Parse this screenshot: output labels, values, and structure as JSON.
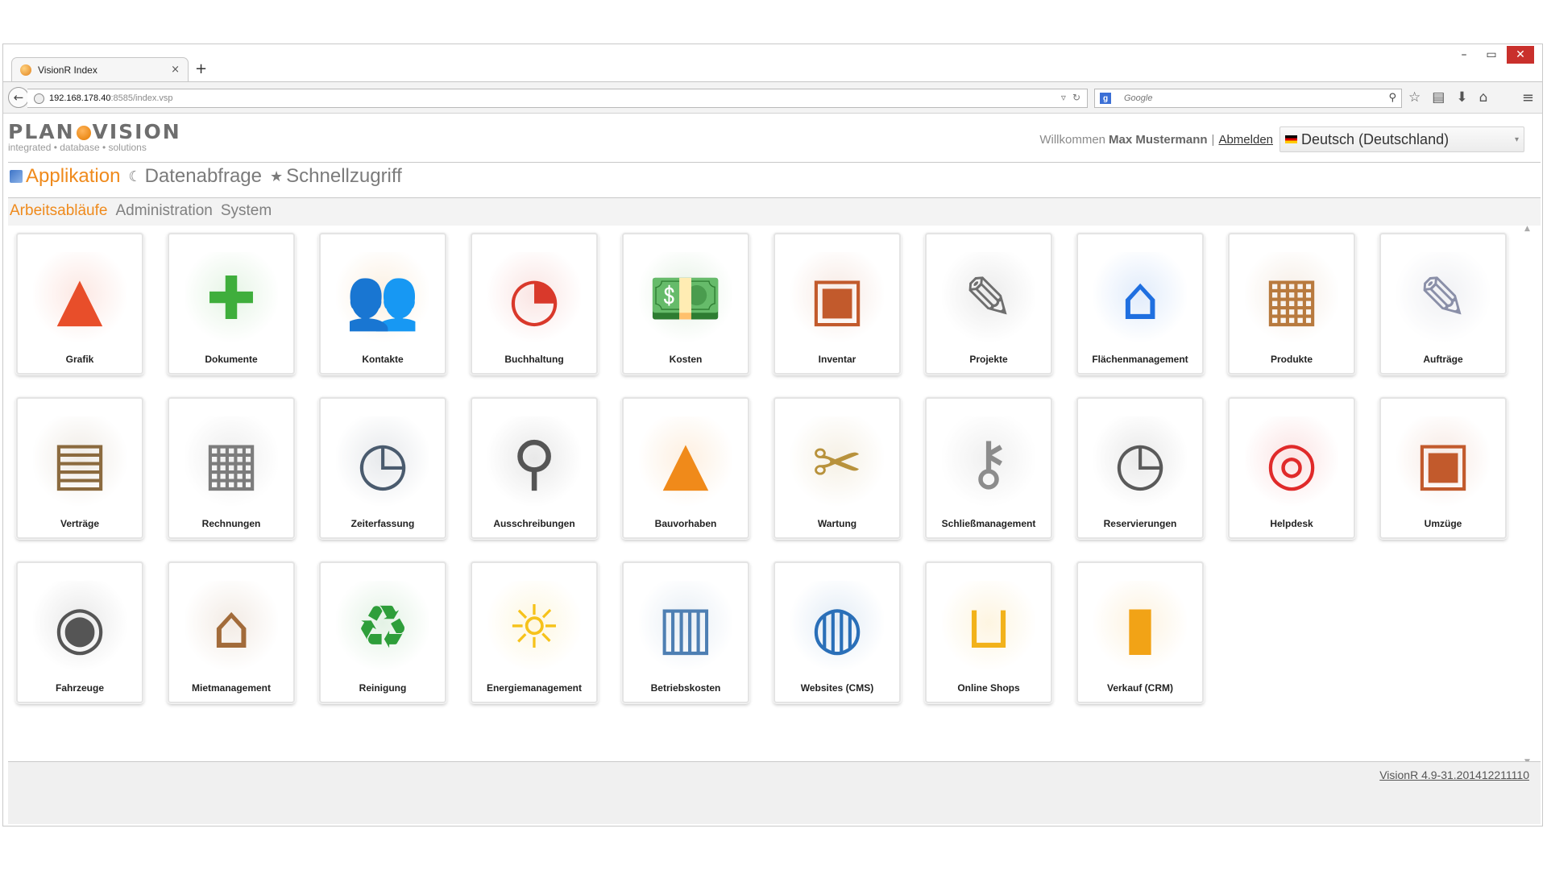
{
  "browser": {
    "tab_title": "VisionR Index",
    "tab_close": "×",
    "new_tab": "+",
    "window_controls": {
      "minimize": "–",
      "maximize": "▭",
      "close": "✕"
    },
    "url_host": "192.168.178.40",
    "url_path": ":8585/index.vsp",
    "url_icons": {
      "dropdown": "▿",
      "reload": "↻"
    },
    "search_engine_icon": "g",
    "search_placeholder": "Google",
    "search_glyph": "⚲",
    "toolbar": {
      "bookmark_star": "☆",
      "bookmarks_list": "▤",
      "download": "⬇",
      "home": "⌂",
      "menu": "≡"
    },
    "back": "←"
  },
  "header": {
    "logo_left": "PLAN",
    "logo_right": "VISION",
    "tagline": "integrated • database • solutions",
    "welcome": "Willkommen",
    "user_name": "Max Mustermann",
    "separator": "|",
    "logout": "Abmelden",
    "language": "Deutsch (Deutschland)",
    "language_arrow": "▾"
  },
  "main_nav": [
    {
      "label": "Applikation",
      "icon": "app-icon"
    },
    {
      "label": "Datenabfrage",
      "icon": "query-icon",
      "glyph": "☾"
    },
    {
      "label": "Schnellzugriff",
      "icon": "star-icon",
      "glyph": "★"
    }
  ],
  "sub_nav": [
    "Arbeitsabläufe",
    "Administration",
    "System"
  ],
  "tiles": [
    {
      "label": "Grafik",
      "icon": "graphic-shapes-icon",
      "glyph": "▲",
      "color": "#e84e2a"
    },
    {
      "label": "Dokumente",
      "icon": "documents-folder-icon",
      "glyph": "✚",
      "color": "#3fae3c"
    },
    {
      "label": "Kontakte",
      "icon": "contacts-people-icon",
      "glyph": "👥",
      "color": "#e28a1e"
    },
    {
      "label": "Buchhaltung",
      "icon": "accounting-chart-icon",
      "glyph": "◔",
      "color": "#d9392b"
    },
    {
      "label": "Kosten",
      "icon": "money-icon",
      "glyph": "💵",
      "color": "#3c9a3c"
    },
    {
      "label": "Inventar",
      "icon": "inventory-box-icon",
      "glyph": "▣",
      "color": "#c25a2c"
    },
    {
      "label": "Projekte",
      "icon": "projects-calendar-icon",
      "glyph": "✎",
      "color": "#6e6e6e"
    },
    {
      "label": "Flächenmanagement",
      "icon": "home-circle-icon",
      "glyph": "⌂",
      "color": "#1f6fe0"
    },
    {
      "label": "Produkte",
      "icon": "products-crate-icon",
      "glyph": "▦",
      "color": "#b87a3e"
    },
    {
      "label": "Aufträge",
      "icon": "orders-pencil-icon",
      "glyph": "✎",
      "color": "#8a8fa8"
    },
    {
      "label": "Verträge",
      "icon": "contracts-cabinet-icon",
      "glyph": "▤",
      "color": "#8b6a3e"
    },
    {
      "label": "Rechnungen",
      "icon": "calculator-icon",
      "glyph": "▦",
      "color": "#7c7c7c"
    },
    {
      "label": "Zeiterfassung",
      "icon": "time-clock-icon",
      "glyph": "◷",
      "color": "#4a5b6e"
    },
    {
      "label": "Ausschreibungen",
      "icon": "magnifier-document-icon",
      "glyph": "⚲",
      "color": "#555555"
    },
    {
      "label": "Bauvorhaben",
      "icon": "traffic-cone-icon",
      "glyph": "▲",
      "color": "#f08a1a"
    },
    {
      "label": "Wartung",
      "icon": "maintenance-tools-icon",
      "glyph": "✂",
      "color": "#b8923c"
    },
    {
      "label": "Schließmanagement",
      "icon": "keys-icon",
      "glyph": "⚷",
      "color": "#8c8c8c"
    },
    {
      "label": "Reservierungen",
      "icon": "reservation-calendar-clock-icon",
      "glyph": "◷",
      "color": "#5a5a5a"
    },
    {
      "label": "Helpdesk",
      "icon": "lifebuoy-icon",
      "glyph": "◎",
      "color": "#e02a2a"
    },
    {
      "label": "Umzüge",
      "icon": "moving-box-icon",
      "glyph": "▣",
      "color": "#c25a2c"
    },
    {
      "label": "Fahrzeuge",
      "icon": "tire-icon",
      "glyph": "◉",
      "color": "#555555"
    },
    {
      "label": "Mietmanagement",
      "icon": "rental-house-icon",
      "glyph": "⌂",
      "color": "#a26b3a"
    },
    {
      "label": "Reinigung",
      "icon": "recycle-bin-icon",
      "glyph": "♻",
      "color": "#2e9e3a"
    },
    {
      "label": "Energiemanagement",
      "icon": "light-bulb-icon",
      "glyph": "☼",
      "color": "#f6c21a"
    },
    {
      "label": "Betriebskosten",
      "icon": "building-calculator-icon",
      "glyph": "▥",
      "color": "#4e7fb3"
    },
    {
      "label": "Websites (CMS)",
      "icon": "html-globe-icon",
      "glyph": "◍",
      "color": "#2a6fb8"
    },
    {
      "label": "Online Shops",
      "icon": "shopping-basket-icon",
      "glyph": "⊔",
      "color": "#f2b21b"
    },
    {
      "label": "Verkauf (CRM)",
      "icon": "sales-chart-circle-icon",
      "glyph": "▮",
      "color": "#f2a316"
    }
  ],
  "scrollbar": {
    "up": "▲",
    "down": "▼"
  },
  "footer": {
    "version": "VisionR 4.9-31.201412211110"
  },
  "colors": {
    "accent": "#ef8a1c",
    "close_button": "#c9302c"
  }
}
